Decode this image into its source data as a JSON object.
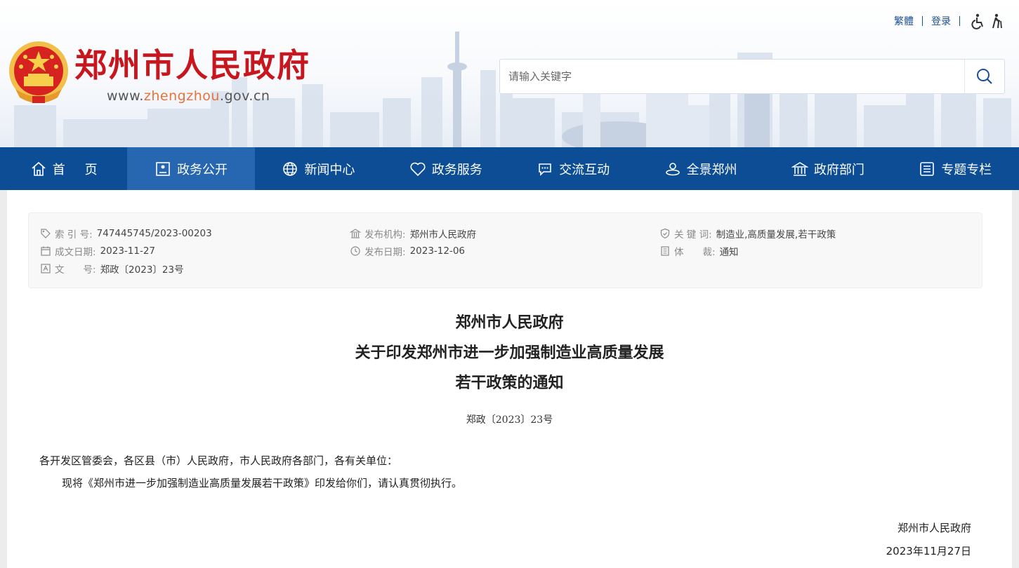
{
  "header": {
    "title": "郑州市人民政府",
    "url_prefix": "www.",
    "url_mid": "zhengzhou",
    "url_suffix": ".gov.cn",
    "top_links": {
      "traditional": "繁體",
      "login": "登录"
    },
    "search": {
      "placeholder": "请输入关键字"
    },
    "colors": {
      "title_red": "#c8161e",
      "nav_blue": "#0c4d96",
      "nav_active": "#2767b1"
    }
  },
  "nav": {
    "items": [
      {
        "label": "首页",
        "icon": "home-icon"
      },
      {
        "label": "政务公开",
        "icon": "document-icon",
        "active": true
      },
      {
        "label": "新闻中心",
        "icon": "globe-icon"
      },
      {
        "label": "政务服务",
        "icon": "heart-icon"
      },
      {
        "label": "交流互动",
        "icon": "chat-icon"
      },
      {
        "label": "全景郑州",
        "icon": "panorama-icon"
      },
      {
        "label": "政府部门",
        "icon": "government-building-icon"
      },
      {
        "label": "专题专栏",
        "icon": "list-icon"
      }
    ]
  },
  "meta": {
    "index_label": "索 引 号:",
    "index_value": "747445745/2023-00203",
    "created_label": "成文日期:",
    "created_value": "2023-11-27",
    "docno_label": "文　　号:",
    "docno_value": "郑政〔2023〕23号",
    "publisher_label": "发布机构:",
    "publisher_value": "郑州市人民政府",
    "published_label": "发布日期:",
    "published_value": "2023-12-06",
    "keywords_label": "关 键 词:",
    "keywords_value": "制造业,高质量发展,若干政策",
    "genre_label": "体　　裁:",
    "genre_value": "通知"
  },
  "document": {
    "title_lines": [
      "郑州市人民政府",
      "关于印发郑州市进一步加强制造业高质量发展",
      "若干政策的通知"
    ],
    "number": "郑政〔2023〕23号",
    "salutation": "各开发区管委会，各区县（市）人民政府，市人民政府各部门，各有关单位：",
    "body": "现将《郑州市进一步加强制造业高质量发展若干政策》印发给你们，请认真贯彻执行。",
    "signature": "郑州市人民政府",
    "date": "2023年11月27日"
  }
}
